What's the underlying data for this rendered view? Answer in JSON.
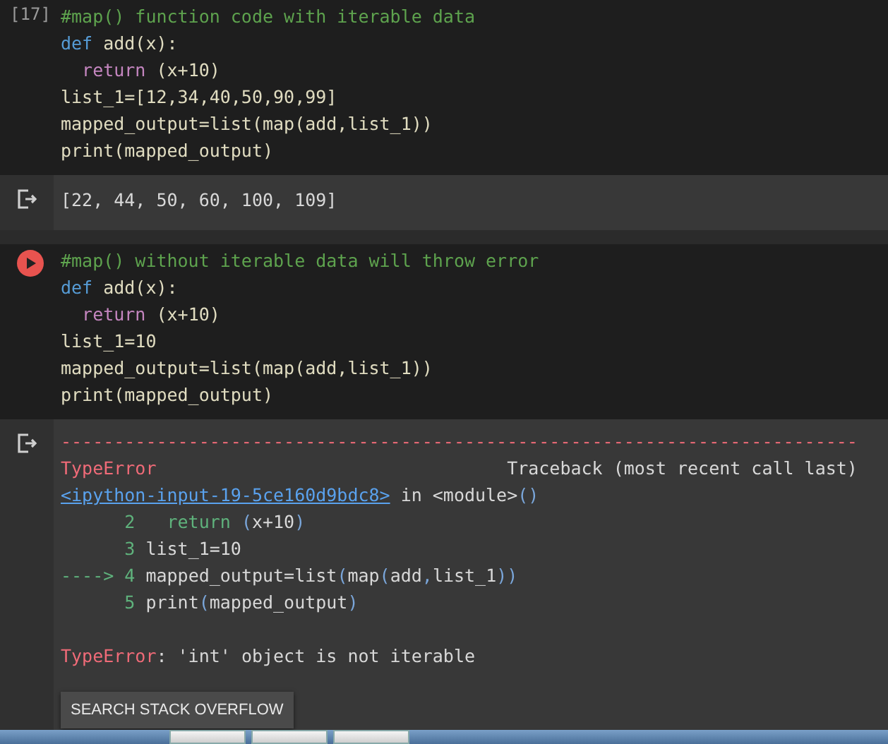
{
  "cells": [
    {
      "exec_label": "[17]",
      "running": false,
      "code": [
        [
          {
            "text": "#map() function code with iterable data",
            "kind": "comment"
          }
        ],
        [
          {
            "text": "def",
            "kind": "keyword"
          },
          {
            "text": " add(x):",
            "kind": "plain"
          }
        ],
        [
          {
            "text": "  return",
            "kind": "control"
          },
          {
            "text": " (x+10)",
            "kind": "plain"
          }
        ],
        [
          {
            "text": "list_1=[12,34,40,50,90,99]",
            "kind": "plain"
          }
        ],
        [
          {
            "text": "mapped_output=list(map(add,list_1))",
            "kind": "plain"
          }
        ],
        [
          {
            "text": "print(mapped_output)",
            "kind": "plain"
          }
        ]
      ],
      "output": {
        "kind": "text",
        "lines": [
          {
            "kind": "result",
            "tokens": [
              {
                "text": "[22, 44, 50, 60, 100, 109]",
                "kind": "plain"
              }
            ]
          }
        ]
      }
    },
    {
      "running": true,
      "code": [
        [
          {
            "text": "#map() without iterable data will throw error",
            "kind": "comment"
          }
        ],
        [
          {
            "text": "def",
            "kind": "keyword"
          },
          {
            "text": " add(x):",
            "kind": "plain"
          }
        ],
        [
          {
            "text": "  return",
            "kind": "control"
          },
          {
            "text": " (x+10)",
            "kind": "plain"
          }
        ],
        [
          {
            "text": "list_1=10",
            "kind": "plain"
          }
        ],
        [
          {
            "text": "mapped_output=list(map(add,list_1))",
            "kind": "plain"
          }
        ],
        [
          {
            "text": "print(mapped_output)",
            "kind": "plain"
          }
        ]
      ],
      "output": {
        "kind": "error",
        "lines": [
          {
            "kind": "traceback",
            "tokens": [
              {
                "text": "---------------------------------------------------------------------------",
                "kind": "error"
              }
            ]
          },
          {
            "kind": "traceback",
            "tokens": [
              {
                "text": "TypeError",
                "kind": "error"
              },
              {
                "text": "                                 Traceback (most recent call last)",
                "kind": "plain"
              }
            ]
          },
          {
            "kind": "traceback",
            "tokens": [
              {
                "text": "<ipython-input-19-5ce160d9bdc8>",
                "kind": "link"
              },
              {
                "text": " in <module>",
                "kind": "plain"
              },
              {
                "text": "()",
                "kind": "paren"
              }
            ]
          },
          {
            "kind": "traceback",
            "tokens": [
              {
                "text": "      2   return",
                "kind": "lineno"
              },
              {
                "text": " (",
                "kind": "paren"
              },
              {
                "text": "x+10",
                "kind": "plain"
              },
              {
                "text": ")",
                "kind": "paren"
              }
            ]
          },
          {
            "kind": "traceback",
            "tokens": [
              {
                "text": "      3",
                "kind": "lineno"
              },
              {
                "text": " list_1=10",
                "kind": "plain"
              }
            ]
          },
          {
            "kind": "traceback",
            "tokens": [
              {
                "text": "----> 4",
                "kind": "lineno"
              },
              {
                "text": " mapped_output=list",
                "kind": "plain"
              },
              {
                "text": "(",
                "kind": "paren"
              },
              {
                "text": "map",
                "kind": "plain"
              },
              {
                "text": "(",
                "kind": "paren"
              },
              {
                "text": "add",
                "kind": "plain"
              },
              {
                "text": ",",
                "kind": "paren"
              },
              {
                "text": "list_1",
                "kind": "plain"
              },
              {
                "text": "))",
                "kind": "paren"
              }
            ]
          },
          {
            "kind": "traceback",
            "tokens": [
              {
                "text": "      5",
                "kind": "lineno"
              },
              {
                "text": " print",
                "kind": "plain"
              },
              {
                "text": "(",
                "kind": "paren"
              },
              {
                "text": "mapped_output",
                "kind": "plain"
              },
              {
                "text": ")",
                "kind": "paren"
              }
            ]
          },
          {
            "kind": "summary",
            "tokens": [
              {
                "text": "TypeError",
                "kind": "error"
              },
              {
                "text": ": 'int' object is not iterable",
                "kind": "plain"
              }
            ]
          }
        ],
        "button": "SEARCH STACK OVERFLOW"
      }
    }
  ]
}
